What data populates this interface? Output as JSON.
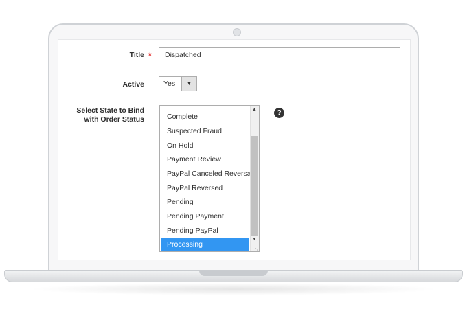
{
  "form": {
    "title_label": "Title",
    "required_mark": "*",
    "title_value": "Dispatched",
    "active_label": "Active",
    "active_value": "Yes",
    "state_label_line1": "Select State to Bind",
    "state_label_line2": "with Order Status",
    "states": [
      "Complete",
      "Suspected Fraud",
      "On Hold",
      "Payment Review",
      "PayPal Canceled Reversal",
      "PayPal Reversed",
      "Pending",
      "Pending Payment",
      "Pending PayPal",
      "Processing"
    ],
    "selected_state": "Processing",
    "help_icon": "question-mark-icon"
  },
  "colors": {
    "accent": "#3296f2",
    "required": "#e22626"
  }
}
